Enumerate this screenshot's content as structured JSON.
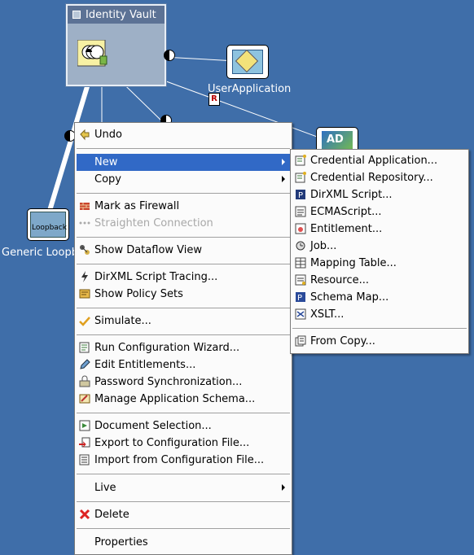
{
  "vault": {
    "title": "Identity Vault"
  },
  "nodes": {
    "user_app": "UserApplication",
    "loopback_icon_text": "Loopback",
    "loopback_label": "Generic Loopba",
    "ad_icon_text": "AD"
  },
  "context_menu": [
    {
      "label": "Undo",
      "icon": "undo-icon"
    },
    {
      "label": "New",
      "submenu": true,
      "highlighted": true
    },
    {
      "label": "Copy",
      "submenu": true
    },
    {
      "label": "Mark as Firewall",
      "icon": "firewall-icon"
    },
    {
      "label": "Straighten Connection",
      "icon": "straighten-icon",
      "disabled": true
    },
    {
      "label": "Show Dataflow View",
      "icon": "dataflow-icon"
    },
    {
      "label": "DirXML Script Tracing...",
      "icon": "tracing-icon"
    },
    {
      "label": "Show Policy Sets",
      "icon": "policy-sets-icon"
    },
    {
      "label": "Simulate...",
      "icon": "simulate-icon"
    },
    {
      "label": "Run Configuration Wizard...",
      "icon": "wizard-icon"
    },
    {
      "label": "Edit Entitlements...",
      "icon": "pencil-icon"
    },
    {
      "label": "Password Synchronization...",
      "icon": "password-sync-icon"
    },
    {
      "label": "Manage Application Schema...",
      "icon": "schema-icon"
    },
    {
      "label": "Document Selection...",
      "icon": "document-icon"
    },
    {
      "label": "Export to Configuration File...",
      "icon": "export-icon"
    },
    {
      "label": "Import from Configuration File...",
      "icon": "import-icon"
    },
    {
      "label": "Live",
      "submenu": true
    },
    {
      "label": "Delete",
      "icon": "delete-icon"
    },
    {
      "label": "Properties"
    }
  ],
  "new_submenu": [
    {
      "label": "Credential Application...",
      "icon": "credential-application-icon"
    },
    {
      "label": "Credential Repository...",
      "icon": "credential-repository-icon"
    },
    {
      "label": "DirXML Script...",
      "icon": "dirxml-script-icon"
    },
    {
      "label": "ECMAScript...",
      "icon": "ecmascript-icon"
    },
    {
      "label": "Entitlement...",
      "icon": "entitlement-icon"
    },
    {
      "label": "Job...",
      "icon": "job-icon"
    },
    {
      "label": "Mapping Table...",
      "icon": "mapping-table-icon"
    },
    {
      "label": "Resource...",
      "icon": "resource-icon"
    },
    {
      "label": "Schema Map...",
      "icon": "schema-map-icon"
    },
    {
      "label": "XSLT...",
      "icon": "xslt-icon"
    },
    {
      "label": "From Copy...",
      "icon": "from-copy-icon"
    }
  ],
  "colors": {
    "canvas": "#3f6ea9",
    "menu_highlight": "#3169c6",
    "vault_title_bar": "#5c7295"
  }
}
